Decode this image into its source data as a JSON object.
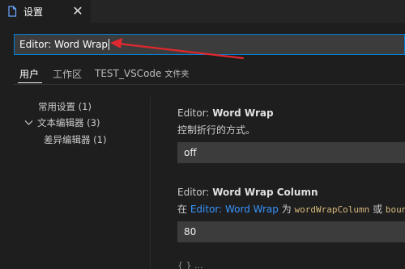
{
  "tab": {
    "title": "设置",
    "icon": "file-icon",
    "close_icon": "close-icon"
  },
  "search": {
    "value": "Editor: Word Wrap"
  },
  "scopes": [
    {
      "label": "用户",
      "active": true
    },
    {
      "label": "工作区",
      "active": false
    },
    {
      "label": "TEST_VSCode",
      "suffix": "文件夹",
      "active": false
    }
  ],
  "tree": [
    {
      "label": "常用设置 (1)"
    },
    {
      "label": "文本编辑器 (3)",
      "expanded": true
    },
    {
      "label": "差异编辑器 (1)"
    }
  ],
  "settings": [
    {
      "category": "Editor:",
      "name": "Word Wrap",
      "description": "控制折行的方式。",
      "value": "off"
    },
    {
      "category": "Editor:",
      "name": "Word Wrap Column",
      "desc_prefix": "在 ",
      "desc_link": "Editor: Word Wrap",
      "desc_mid": " 为 ",
      "desc_code1": "wordWrapColumn",
      "desc_mid2": " 或 ",
      "desc_code2": "bound",
      "value": "80"
    }
  ],
  "partial_next": "{ } ...",
  "colors": {
    "accent": "#007fd4",
    "link": "#3794ff",
    "annotation_arrow": "#e0282e"
  }
}
